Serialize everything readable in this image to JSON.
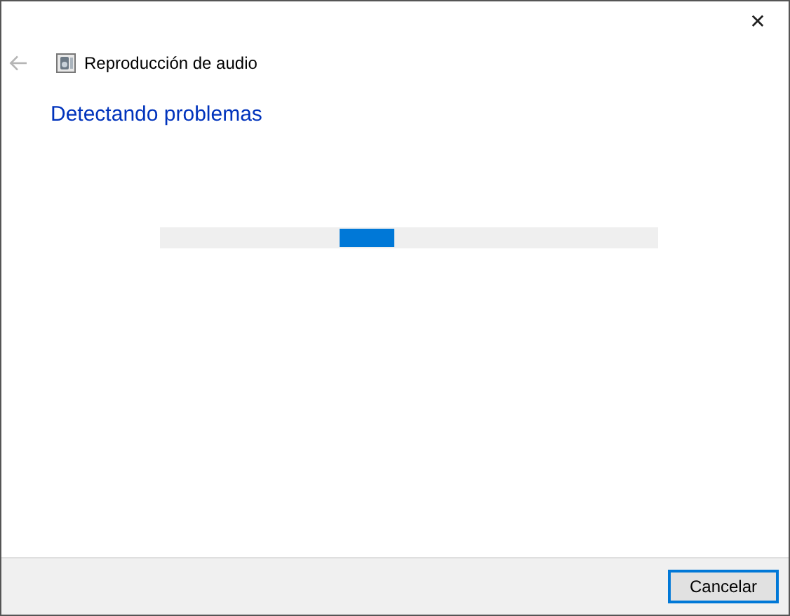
{
  "window": {
    "close": "✕"
  },
  "header": {
    "back_button": {
      "disabled": true
    },
    "title": "Reproducción de audio"
  },
  "heading": "Detectando problemas",
  "progress": {
    "indeterminate": true
  },
  "buttons": [
    {
      "label": "Cancelar",
      "focused": true
    }
  ]
}
